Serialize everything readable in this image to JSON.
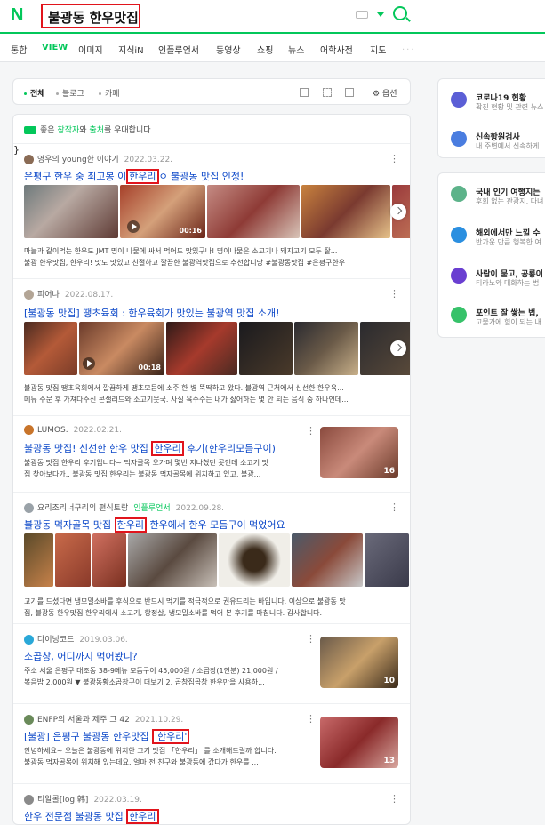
{
  "header": {
    "logo": "N",
    "query": "불광동 한우맛집"
  },
  "tabs": [
    "통합",
    "VIEW",
    "이미지",
    "지식iN",
    "인플루언서",
    "동영상",
    "쇼핑",
    "뉴스",
    "어학사전",
    "지도"
  ],
  "tab_more": "···",
  "filters": {
    "all": "전체",
    "blog": "블로그",
    "cafe": "카페",
    "options": "옵션"
  },
  "notice": {
    "prefix": "좋은 ",
    "creator": "창작자",
    "mid": "와 ",
    "source": "출처",
    "suffix": "를 우대합니다"
  },
  "posts": [
    {
      "author": "영우의 young한 이야기",
      "date": "2022.03.22.",
      "title_pre": "은평구 한우 중 최고봉 이",
      "title_hl": "한우리",
      "title_post": "ㅇ 불광동 맛집 인정!",
      "duration": "00:16",
      "desc1": "마늘과 갈이먹는 한우도 JMT 명이 나물에 싸서 먹어도 맛있구나! 명이나물은 소고기나 돼지고기 모두 잘...",
      "desc2": "불광 한우맛집, 한우리! 맛도 맛있고 친절하고 깔끔한 불광역맛집으로 추천합니당 #불광동맛집 #은평구한우"
    },
    {
      "author": "피어나",
      "date": "2022.08.17.",
      "title": "[불광동 맛집] 땡초육회 : 한우육회가 맛있는 불광역 맛집 소개!",
      "duration": "00:18",
      "desc1": "불광동 맛집 땡초육회에서 깔끔하게 땡초모듬에 소주 한 병 뚝딱하고 왔다. 불광역 근처에서 신선한 한우육...",
      "desc2": "메뉴 주문 후 가져다주신 콘샐러드와 소고기뭇국. 사실 육수수는 내가 싫어하는 몇 안 되는 음식 중 하나인데..."
    },
    {
      "author": "LUMOS.",
      "date": "2022.02.21.",
      "title_pre": "불광동 맛집! 신선한 한우 맛집 ",
      "title_hl": "한우리",
      "title_post": " 후기(한우리모듬구이)",
      "count": "16",
      "desc1": "불광동 맛집 한우리 후기입니다~ 먹자골목 오가며 몇번 지나쳤던 곳인데 소고기 맛",
      "desc2": "집 찾아보다가.. 불광동 맛집 한우리는 불광동 먹자골목에 위치하고 있고, 불광..."
    },
    {
      "author": "요리조리너구리의 편식토랑",
      "influencer": "인플루언서",
      "date": "2022.09.28.",
      "title_pre": "불광동 먹자골목 맛집 ",
      "title_hl": "한우리",
      "title_post": " 한우에서 한우 모듬구이 먹었어요",
      "desc1": "고기를 드셨다면 냉모밀소바를 후식으로 반드시 먹기를 적극적으로 권유드리는 바입니다. 이상으로 불광동 맛",
      "desc2": "집, 불광동 한우맛집 한우리에서 소고기, 항정살, 냉모밀소바를 먹어 본 후기를 마칩니다. 감사합니다."
    },
    {
      "author": "다이닝코드",
      "date": "2019.03.06.",
      "title": "소곱창, 어디까지 먹어봤니?",
      "count": "10",
      "desc1": "주소 서울 은평구 대조동 38-9메뉴 모듬구이 45,000원 / 소곱창(1인분) 21,000원 /",
      "desc2": "볶음밥 2,000원 ▼ 불광동황소곱창구이 더보기 2. 곱창집곱창 한우만을 사용하..."
    },
    {
      "author": "ENFP의 서울과 제주 그 42",
      "date": "2021.10.29.",
      "title_pre": "[불광] 은평구 불광동 한우맛집 ",
      "title_hl": "'한우리'",
      "title_post": "",
      "count": "13",
      "desc1": "안녕하세요~ 오늘은 불광동에 위치한 고기 맛집 「한우리」 를 소개해드릴까 합니다.",
      "desc2": "불광동 먹자골목에 위치해 있는데요. 얼마 전 친구와 불광동에 갔다가 한우를 ..."
    },
    {
      "author": "티알롤[log.韩]",
      "date": "2022.03.19.",
      "title_pre": "한우 전문점 불광동 맛집 ",
      "title_hl": "한우리",
      "title_post": ""
    }
  ],
  "right_top": [
    {
      "title": "코로나19 현황",
      "sub": "확진 현황 및 관련 뉴스",
      "color": "#5b5fd6"
    },
    {
      "title": "신속항원검사",
      "sub": "내 주변에서 신속하게",
      "color": "#4a7de0"
    }
  ],
  "right_bottom": [
    {
      "title": "국내 인기 여행지는",
      "sub": "후회 없는 관광지, 다녀",
      "color": "#5db38a"
    },
    {
      "title": "해외에서만 느낄 수",
      "sub": "반가운 만큼 행복한 여",
      "color": "#2b8fe0"
    },
    {
      "title": "사람이 묻고, 공룡이",
      "sub": "티라노와 대화하는 법",
      "color": "#6a3fd1"
    },
    {
      "title": "포인트 잘 쌓는 법,",
      "sub": "고물가에 힘이 되는 내",
      "color": "#37c26a"
    }
  ]
}
